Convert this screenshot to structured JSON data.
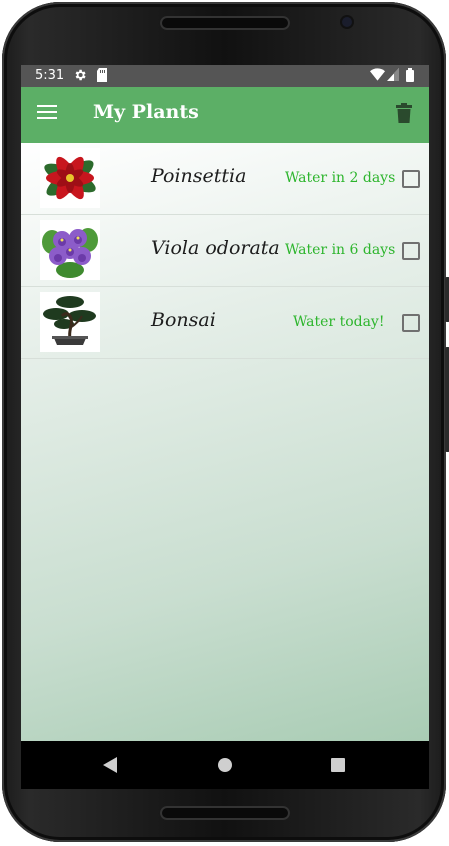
{
  "status_bar": {
    "time": "5:31",
    "icons": [
      "gear-icon",
      "sd-card-icon",
      "wifi-icon",
      "signal-icon",
      "battery-icon"
    ]
  },
  "app_bar": {
    "title": "My Plants",
    "menu_icon": "hamburger-menu-icon",
    "action_icon": "trash-icon",
    "color": "#5caf66"
  },
  "plants": [
    {
      "name": "Poinsettia",
      "water": "Water in 2 days",
      "image": "poinsettia-image",
      "checked": false
    },
    {
      "name": "Viola odorata",
      "water": "Water in 6 days",
      "image": "violet-image",
      "checked": false
    },
    {
      "name": "Bonsai",
      "water": "Water today!",
      "image": "bonsai-image",
      "checked": false
    }
  ],
  "nav_bar": {
    "buttons": [
      "back-icon",
      "home-icon",
      "recents-icon"
    ]
  },
  "colors": {
    "accent": "#5caf66",
    "water_text": "#2db52d",
    "status_bar": "#555555"
  }
}
